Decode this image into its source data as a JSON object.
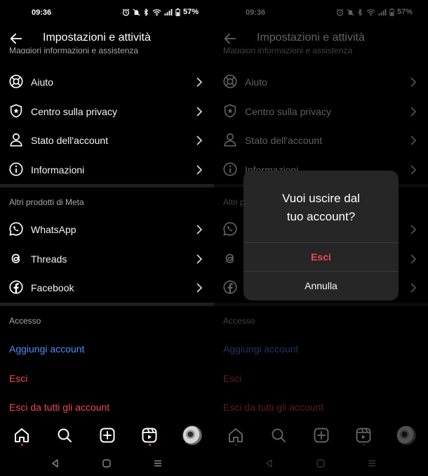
{
  "colors": {
    "background": "#000000",
    "text": "#f5f5f5",
    "secondary_text": "#a8a8a8",
    "link_blue": "#4f8ef7",
    "danger_red": "#ed4956",
    "divider": "#1f1f1f",
    "dialog_bg": "#262626"
  },
  "status_bar": {
    "time": "09:36",
    "battery": "57%",
    "icons": [
      "alarm-icon",
      "mute-icon",
      "bluetooth-icon",
      "wifi-icon",
      "signal-icon",
      "battery-icon"
    ]
  },
  "header": {
    "back_icon": "arrow-left-icon",
    "title": "Impostazioni e attività"
  },
  "sections": {
    "support": {
      "heading": "Maggiori informazioni e assistenza",
      "items": [
        {
          "icon": "lifebuoy-icon",
          "label": "Aiuto"
        },
        {
          "icon": "shield-star-icon",
          "label": "Centro sulla privacy"
        },
        {
          "icon": "person-icon",
          "label": "Stato dell'account"
        },
        {
          "icon": "info-icon",
          "label": "Informazioni"
        }
      ]
    },
    "meta": {
      "heading": "Altri prodotti di Meta",
      "items": [
        {
          "icon": "whatsapp-icon",
          "label": "WhatsApp"
        },
        {
          "icon": "threads-icon",
          "label": "Threads"
        },
        {
          "icon": "facebook-icon",
          "label": "Facebook"
        }
      ]
    },
    "access": {
      "heading": "Accesso",
      "add_account": "Aggiungi account",
      "logout": "Esci",
      "logout_all": "Esci da tutti gli account"
    }
  },
  "bottom_nav": {
    "items": [
      "home-icon",
      "search-icon",
      "create-icon",
      "reels-icon",
      "profile-avatar"
    ]
  },
  "system_nav": {
    "items": [
      "back-triangle-icon",
      "home-circle-icon",
      "recents-icon"
    ]
  },
  "dialog": {
    "title_line1": "Vuoi uscire dal",
    "title_line2": "tuo account?",
    "confirm": "Esci",
    "cancel": "Annulla"
  }
}
